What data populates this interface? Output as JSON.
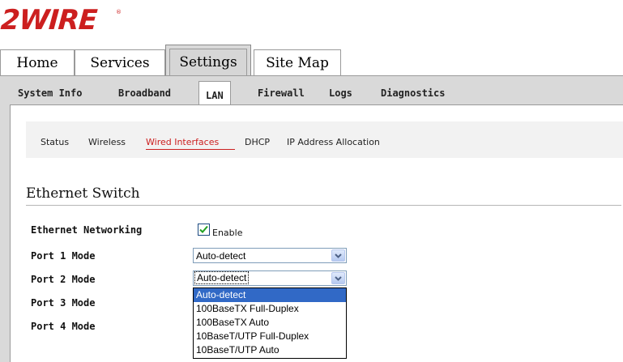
{
  "logo": {
    "text": "2WIRE",
    "registered": "®"
  },
  "top_tabs": [
    {
      "label": "Home"
    },
    {
      "label": "Services"
    },
    {
      "label": "Settings"
    },
    {
      "label": "Site Map"
    }
  ],
  "subnav": [
    {
      "label": "System Info"
    },
    {
      "label": "Broadband"
    },
    {
      "label": "LAN"
    },
    {
      "label": "Firewall"
    },
    {
      "label": "Logs"
    },
    {
      "label": "Diagnostics"
    }
  ],
  "lan_nav": [
    {
      "label": "Status"
    },
    {
      "label": "Wireless"
    },
    {
      "label": "Wired Interfaces"
    },
    {
      "label": "DHCP"
    },
    {
      "label": "IP Address Allocation"
    }
  ],
  "section": {
    "title": "Ethernet Switch"
  },
  "ethernet_networking": {
    "label": "Ethernet Networking",
    "checkbox_label": "Enable",
    "checked": true
  },
  "port1": {
    "label": "Port 1 Mode",
    "value": "Auto-detect"
  },
  "port2": {
    "label": "Port 2 Mode",
    "value": "Auto-detect"
  },
  "port3": {
    "label": "Port 3 Mode"
  },
  "port4": {
    "label": "Port 4 Mode"
  },
  "port2_options": [
    "Auto-detect",
    "100BaseTX Full-Duplex",
    "100BaseTX Auto",
    "10BaseT/UTP Full-Duplex",
    "10BaseT/UTP Auto"
  ],
  "colors": {
    "brand": "#cc1f1f",
    "selection": "#3169c6"
  }
}
